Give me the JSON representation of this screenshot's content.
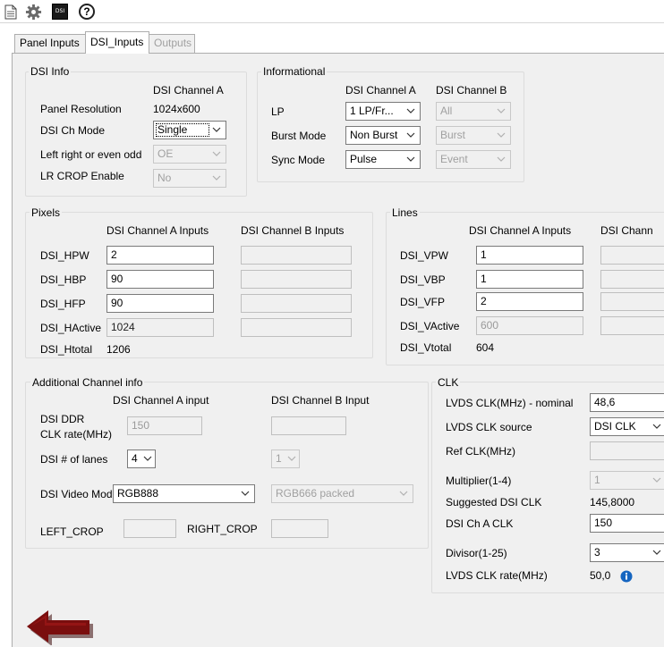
{
  "tabs": [
    {
      "label": "Panel Inputs"
    },
    {
      "label": "DSI_Inputs"
    },
    {
      "label": "Outputs"
    }
  ],
  "toolbar": {
    "dsi_icon_text": "DSI",
    "help_glyph": "?"
  },
  "dsi_info": {
    "title": "DSI Info",
    "col_header": "DSI Channel A",
    "panel_resolution_label": "Panel Resolution",
    "panel_resolution_value": "1024x600",
    "ch_mode_label": "DSI Ch Mode",
    "ch_mode_value": "Single",
    "lr_odd_label": "Left right or even odd",
    "lr_odd_value": "OE",
    "lr_crop_label": "LR CROP Enable",
    "lr_crop_value": "No"
  },
  "informational": {
    "title": "Informational",
    "col_a": "DSI Channel A",
    "col_b": "DSI Channel B",
    "lp_label": "LP",
    "lp_a": "1 LP/Fr...",
    "lp_b": "All",
    "burst_label": "Burst Mode",
    "burst_a": "Non Burst",
    "burst_b": "Burst",
    "sync_label": "Sync Mode",
    "sync_a": "Pulse",
    "sync_b": "Event"
  },
  "pixels": {
    "title": "Pixels",
    "col_a": "DSI Channel A Inputs",
    "col_b": "DSI Channel B Inputs",
    "hpw_label": "DSI_HPW",
    "hpw_a": "2",
    "hbp_label": "DSI_HBP",
    "hbp_a": "90",
    "hfp_label": "DSI_HFP",
    "hfp_a": "90",
    "hactive_label": "DSI_HActive",
    "hactive_a": "1024",
    "htotal_label": "DSI_Htotal",
    "htotal_value": "1206"
  },
  "lines": {
    "title": "Lines",
    "col_a": "DSI Channel A Inputs",
    "col_b": "DSI Chann",
    "vpw_label": "DSI_VPW",
    "vpw_a": "1",
    "vbp_label": "DSI_VBP",
    "vbp_a": "1",
    "vfp_label": "DSI_VFP",
    "vfp_a": "2",
    "vactive_label": "DSI_VActive",
    "vactive_a": "600",
    "vtotal_label": "DSI_Vtotal",
    "vtotal_value": "604"
  },
  "additional": {
    "title": "Additional Channel info",
    "col_a": "DSI Channel A input",
    "col_b": "DSI Channel B Input",
    "ddr_label_1": "DSI DDR",
    "ddr_label_2": "CLK rate(MHz)",
    "ddr_a": "150",
    "lanes_label": "DSI # of lanes",
    "lanes_a": "4",
    "lanes_b": "1",
    "video_mode_label": "DSI Video Mode",
    "video_mode_a": "RGB888",
    "video_mode_b": "RGB666 packed",
    "left_crop_label": "LEFT_CROP",
    "right_crop_label": "RIGHT_CROP"
  },
  "clk": {
    "title": "CLK",
    "lvds_nominal_label": "LVDS CLK(MHz) - nominal",
    "lvds_nominal_value": "48,6",
    "lvds_source_label": "LVDS CLK source",
    "lvds_source_value": "DSI CLK",
    "ref_clk_label": "Ref CLK(MHz)",
    "multiplier_label": "Multiplier(1-4)",
    "multiplier_value": "1",
    "suggested_label": "Suggested DSI CLK",
    "suggested_value": "145,8000",
    "ch_a_clk_label": "DSI Ch A CLK",
    "ch_a_clk_value": "150",
    "divisor_label": "Divisor(1-25)",
    "divisor_value": "3",
    "lvds_rate_label": "LVDS CLK rate(MHz)",
    "lvds_rate_value": "50,0"
  },
  "colors": {
    "back_arrow": "#7a0e0e",
    "info_icon": "#1565c0"
  }
}
